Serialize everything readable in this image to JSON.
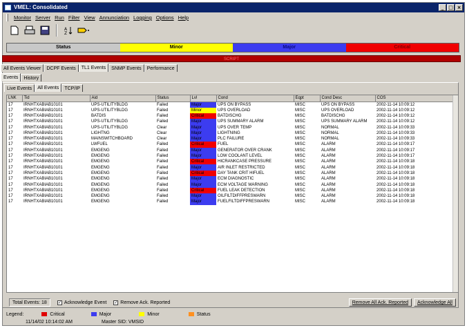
{
  "window": {
    "title": "VMEL: Consolidated",
    "buttons": [
      "_",
      "□",
      "×"
    ]
  },
  "menu": [
    "Monitor",
    "Server",
    "Run",
    "Filter",
    "View",
    "Annunciation",
    "Logging",
    "Options",
    "Help"
  ],
  "toolbar": {
    "icons": [
      "new-icon",
      "print-icon",
      "save-icon",
      "sort-icon",
      "filter-icon"
    ]
  },
  "severity": {
    "status": "Status",
    "minor": "Minor",
    "major": "Major",
    "critical": "Critical"
  },
  "alarm_banner": "SCRIPT",
  "main_tabs": [
    "All Events Viewer",
    "DCPF Events",
    "TL1 Events",
    "SNMP Events",
    "Performance"
  ],
  "sub_tabs": [
    "Events",
    "History"
  ],
  "event_tabs": [
    "Live Events",
    "All Events",
    "TCP/IP"
  ],
  "columns": [
    "LNK",
    "Tid",
    "Aid",
    "Status",
    "Lvl",
    "Cond",
    "Eqpt",
    "Cond Desc",
    "COS"
  ],
  "rows": [
    [
      "17",
      "IRNHTXABIAB10101",
      "UPS-UTILITYBLDG",
      "Failed",
      "Major",
      "UPS ON BYPASS",
      "MISC",
      "UPS ON BYPASS",
      "2002-11-14 10:09:12"
    ],
    [
      "17",
      "IRNHTXABIAB10101",
      "UPS-UTILITYBLDG",
      "Failed",
      "Minor",
      "UPS OVERLOAD",
      "MISC",
      "UPS OVERLOAD",
      "2002-11-14 10:09:12"
    ],
    [
      "17",
      "IRNHTXABIAB10101",
      "BATDIS",
      "Failed",
      "Critical",
      "BATDISCHG",
      "MISC",
      "BATDISCHG",
      "2002-11-14 10:09:12"
    ],
    [
      "17",
      "IRNHTXABIAB10101",
      "UPS-UTILITYBLDG",
      "Failed",
      "Major",
      "UPS SUMMARY ALARM",
      "MISC",
      "UPS SUMMARY ALARM",
      "2002-11-14 10:09:12"
    ],
    [
      "17",
      "IRNHTXABIAB10101",
      "UPS-UTILITYBLDG",
      "Clear",
      "Major",
      "UPS OVER TEMP",
      "MISC",
      "NORMAL",
      "2002-11-14 10:09:33"
    ],
    [
      "17",
      "IRNHTXABIAB10101",
      "LIGHTNG",
      "Clear",
      "Major",
      "LIGHTNING",
      "MISC",
      "NORMAL",
      "2002-11-14 10:09:33"
    ],
    [
      "17",
      "IRNHTXABIAB10101",
      "MAINSWITCHBOARD",
      "Clear",
      "Major",
      "PLC FAILURE",
      "MISC",
      "NORMAL",
      "2002-11-14 10:09:33"
    ],
    [
      "17",
      "IRNHTXABIAB10101",
      "LWFUEL",
      "Failed",
      "Critical",
      "FUEL",
      "MISC",
      "ALARM",
      "2002-11-14 10:09:17"
    ],
    [
      "17",
      "IRNHTXABIAB10101",
      "EMGENG",
      "Failed",
      "Major",
      "GENERATOR OVER CRANK",
      "MISC",
      "ALARM",
      "2002-11-14 10:09:17"
    ],
    [
      "17",
      "IRNHTXABIAB10101",
      "EMGENG",
      "Failed",
      "Major",
      "LOW COOLANT LEVEL",
      "MISC",
      "ALARM",
      "2002-11-14 10:09:17"
    ],
    [
      "17",
      "IRNHTXABIAB10101",
      "EMGENG",
      "Failed",
      "Critical",
      "HICRANKCASE PRESSURE",
      "MISC",
      "ALARM",
      "2002-11-14 10:09:18"
    ],
    [
      "17",
      "IRNHTXABIAB10101",
      "EMGENG",
      "Failed",
      "Major",
      "AIR INLET RESTRICTED",
      "MISC",
      "ALARM",
      "2002-11-14 10:09:18"
    ],
    [
      "17",
      "IRNHTXABIAB10101",
      "EMGENG",
      "Failed",
      "Critical",
      "DAY TANK CRIT HIFUEL",
      "MISC",
      "ALARM",
      "2002-11-14 10:09:18"
    ],
    [
      "17",
      "IRNHTXABIAB10101",
      "EMGENG",
      "Failed",
      "Major",
      "ECM DIAGNOSTIC",
      "MISC",
      "ALARM",
      "2002-11-14 10:09:18"
    ],
    [
      "17",
      "IRNHTXABIAB10101",
      "EMGENG",
      "Failed",
      "Major",
      "ECM VOLTAGE WARNING",
      "MISC",
      "ALARM",
      "2002-11-14 10:09:18"
    ],
    [
      "17",
      "IRNHTXABIAB10101",
      "EMGENG",
      "Failed",
      "Critical",
      "FUEL LEAK DETECTION",
      "MISC",
      "ALARM",
      "2002-11-14 10:09:18"
    ],
    [
      "17",
      "IRNHTXABIAB10101",
      "EMGENG",
      "Failed",
      "Major",
      "OILFILTDIFFPRESWARN",
      "MISC",
      "ALARM",
      "2002-11-14 10:09:18"
    ],
    [
      "17",
      "IRNHTXABIAB10101",
      "EMGENG",
      "Failed",
      "Major",
      "FUELFILTDIFFPRESWARN",
      "MISC",
      "ALARM",
      "2002-11-14 10:09:18"
    ]
  ],
  "level_colors": {
    "Major": "#3c3cf0",
    "Minor": "#ffff00",
    "Critical": "#f00000",
    "Normal": "#00e000"
  },
  "footer": {
    "total_events": "Total Events: 18",
    "ack_event": "Acknowledge Event",
    "remove_ack": "Remove Ack. Reported",
    "remove_all_btn": "Remove All Ack. Reported",
    "ack_all_btn": "Acknowledge All"
  },
  "legend": {
    "label": "Legend:",
    "items": [
      {
        "label": "Critical",
        "color": "#e00000"
      },
      {
        "label": "Major",
        "color": "#3c3cf0"
      },
      {
        "label": "Minor",
        "color": "#ffff00"
      },
      {
        "label": "Status",
        "color": "#ff9020"
      }
    ],
    "datetime": "11/14/02 10:14:02 AM",
    "master_sid": "Master SID: VMSID"
  }
}
